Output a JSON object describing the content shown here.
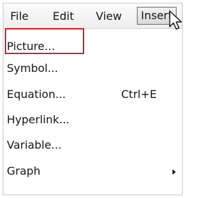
{
  "menubar": {
    "items": [
      {
        "label": "File"
      },
      {
        "label": "Edit"
      },
      {
        "label": "View"
      },
      {
        "label": "Insert"
      }
    ],
    "active_item": "Insert"
  },
  "insert_menu": {
    "items": [
      {
        "label": "Picture...",
        "shortcut": "",
        "has_submenu": false,
        "highlighted": true
      },
      {
        "label": "Symbol...",
        "shortcut": "",
        "has_submenu": false
      },
      {
        "label": "Equation...",
        "shortcut": "Ctrl+E",
        "has_submenu": false
      },
      {
        "label": "Hyperlink...",
        "shortcut": "",
        "has_submenu": false
      },
      {
        "label": "Variable...",
        "shortcut": "",
        "has_submenu": false
      },
      {
        "label": "Graph",
        "shortcut": "",
        "has_submenu": true
      }
    ]
  },
  "colors": {
    "highlight_border": "#cc2128",
    "menubar_background": "#eeeeee",
    "menu_background": "#ffffff",
    "text": "#161616"
  },
  "icons": {
    "cursor": "mouse-pointer-icon",
    "submenu": "submenu-arrow-icon"
  }
}
